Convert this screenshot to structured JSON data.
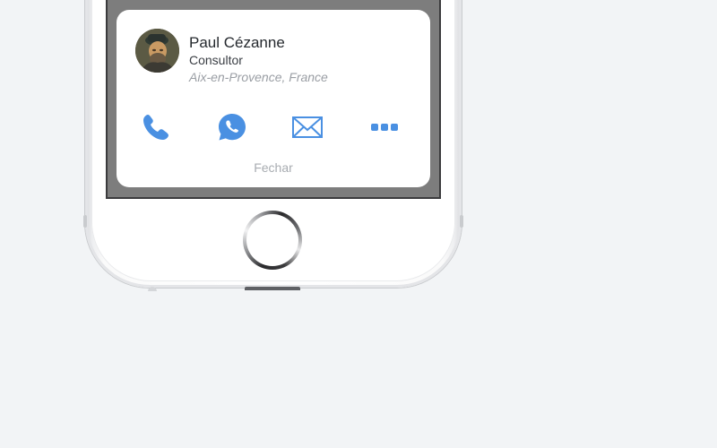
{
  "contact": {
    "name": "Paul Cézanne",
    "role": "Consultor",
    "location": "Aix-en-Provence, France"
  },
  "actions": [
    {
      "icon": "phone-icon",
      "name": "call"
    },
    {
      "icon": "whatsapp-icon",
      "name": "whatsapp"
    },
    {
      "icon": "mail-icon",
      "name": "email"
    },
    {
      "icon": "more-icon",
      "name": "more"
    }
  ],
  "close_label": "Fechar",
  "colors": {
    "accent": "#4a90e2",
    "background": "#f2f4f6",
    "screen_dim": "#7d7d7d"
  }
}
